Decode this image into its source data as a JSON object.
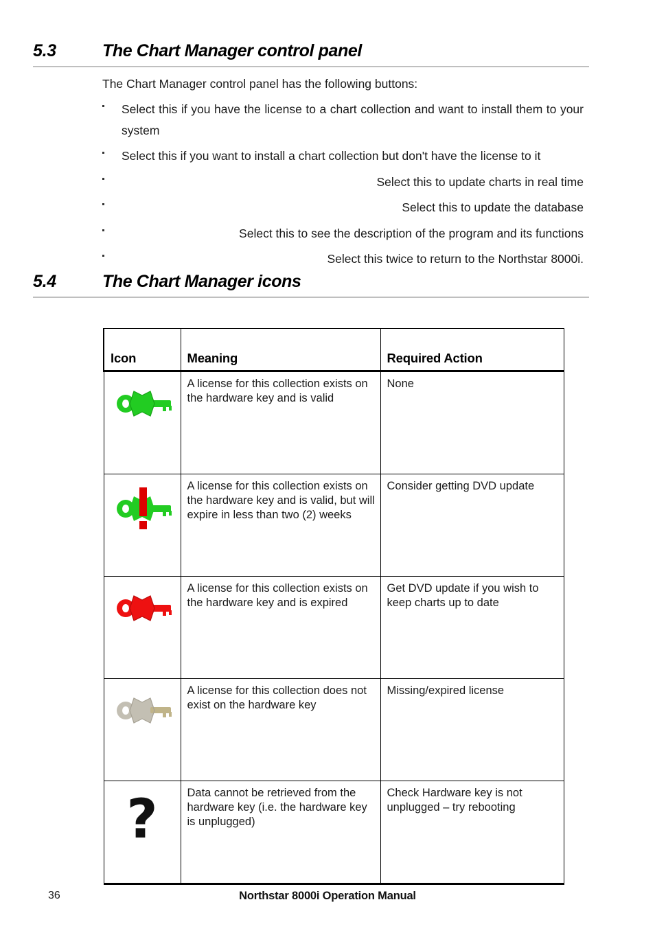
{
  "document": {
    "title": "Northstar 8000i Operation Manual",
    "page_number": "36"
  },
  "sections": {
    "control_panel": {
      "number": "5.3",
      "title": "The Chart Manager control panel",
      "intro": "The Chart Manager control panel has the following buttons:",
      "bullets": [
        {
          "text": "Select this if you have the license to a chart collection and want to install them to your system",
          "lines": 2
        },
        {
          "text": "Select this if you want to install a chart collection but don't have the license to it",
          "lines": 2
        },
        {
          "text": "Select this to update charts in real time",
          "lines": 1
        },
        {
          "text": "Select this to update the database",
          "lines": 1
        },
        {
          "text": "Select this to see the description of the program and its functions",
          "lines": 1
        },
        {
          "text": "Select this twice to return to the Northstar 8000i.",
          "lines": 1
        }
      ]
    },
    "icons": {
      "number": "5.4",
      "title": "The Chart Manager icons"
    }
  },
  "icon_table": {
    "headers": [
      "Icon",
      "Meaning",
      "Required Action"
    ],
    "rows": [
      {
        "icon": "green-key-icon",
        "meaning": "A license for this collection exists on the hardware key and is valid",
        "action": "None"
      },
      {
        "icon": "green-key-warning-icon",
        "meaning": "A license for this collection exists on the hardware key and is valid, but will expire in less than two (2) weeks",
        "action": "Consider getting DVD update"
      },
      {
        "icon": "red-key-icon",
        "meaning": "A license for this collection exists on the hardware key and is expired",
        "action": "Get DVD update if you wish to keep charts up to date"
      },
      {
        "icon": "grey-key-icon",
        "meaning": "A license for this collection does not exist on the hardware key",
        "action": "Missing/expired license"
      },
      {
        "icon": "question-mark-icon",
        "meaning": "Data cannot be retrieved from the hardware key (i.e. the hardware key is unplugged)",
        "action": "Check Hardware key is not unplugged – try rebooting",
        "glyph": "?"
      }
    ]
  },
  "colors": {
    "key_green": "#22cc22",
    "key_red": "#ee1111",
    "key_grey": "#b9b4a6",
    "warning_red": "#dd0000",
    "rule_grey": "#bfbfbf",
    "text": "#1a1a1a"
  }
}
